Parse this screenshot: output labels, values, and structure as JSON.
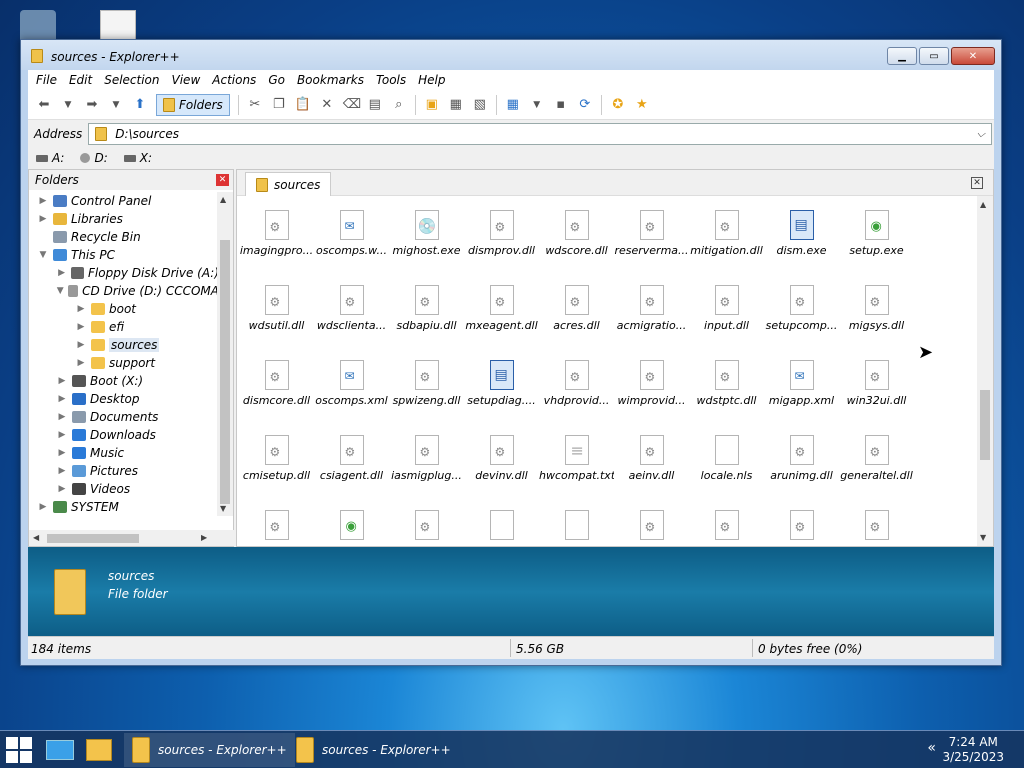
{
  "window": {
    "title": "sources - Explorer++"
  },
  "menu": [
    "File",
    "Edit",
    "Selection",
    "View",
    "Actions",
    "Go",
    "Bookmarks",
    "Tools",
    "Help"
  ],
  "toolbar": {
    "folders_label": "Folders"
  },
  "address": {
    "label": "Address",
    "value": "D:\\sources"
  },
  "drives": [
    "A:",
    "D:",
    "X:"
  ],
  "folders_pane": {
    "title": "Folders",
    "items": [
      {
        "label": "Control Panel",
        "indent": 0,
        "arrow": ">",
        "icon_color": "#4a7cc4"
      },
      {
        "label": "Libraries",
        "indent": 0,
        "arrow": ">",
        "icon_color": "#e8b63c"
      },
      {
        "label": "Recycle Bin",
        "indent": 0,
        "arrow": "",
        "icon_color": "#8a9aac"
      },
      {
        "label": "This PC",
        "indent": 0,
        "arrow": "v",
        "icon_color": "#3f8ad8"
      },
      {
        "label": "Floppy Disk Drive (A:)",
        "indent": 1,
        "arrow": ">",
        "icon_color": "#666666"
      },
      {
        "label": "CD Drive (D:) CCCOMA",
        "indent": 1,
        "arrow": "v",
        "icon_color": "#999999"
      },
      {
        "label": "boot",
        "indent": 2,
        "arrow": ">",
        "icon_color": "#f3c34b"
      },
      {
        "label": "efi",
        "indent": 2,
        "arrow": ">",
        "icon_color": "#f3c34b"
      },
      {
        "label": "sources",
        "indent": 2,
        "arrow": ">",
        "icon_color": "#f3c34b",
        "selected": true
      },
      {
        "label": "support",
        "indent": 2,
        "arrow": ">",
        "icon_color": "#f3c34b"
      },
      {
        "label": "Boot (X:)",
        "indent": 1,
        "arrow": ">",
        "icon_color": "#555555"
      },
      {
        "label": "Desktop",
        "indent": 1,
        "arrow": ">",
        "icon_color": "#2a6fc8"
      },
      {
        "label": "Documents",
        "indent": 1,
        "arrow": ">",
        "icon_color": "#8a9aac"
      },
      {
        "label": "Downloads",
        "indent": 1,
        "arrow": ">",
        "icon_color": "#2a7ad8"
      },
      {
        "label": "Music",
        "indent": 1,
        "arrow": ">",
        "icon_color": "#2a7ad8"
      },
      {
        "label": "Pictures",
        "indent": 1,
        "arrow": ">",
        "icon_color": "#5a9ad8"
      },
      {
        "label": "Videos",
        "indent": 1,
        "arrow": ">",
        "icon_color": "#444444"
      },
      {
        "label": "SYSTEM",
        "indent": 0,
        "arrow": ">",
        "icon_color": "#4a8a4a"
      }
    ]
  },
  "tab": {
    "label": "sources"
  },
  "files": [
    {
      "name": "imagingpro...",
      "kind": "dll"
    },
    {
      "name": "oscomps.w...",
      "kind": "xml"
    },
    {
      "name": "mighost.exe",
      "kind": "cd"
    },
    {
      "name": "dismprov.dll",
      "kind": "dll"
    },
    {
      "name": "wdscore.dll",
      "kind": "dll"
    },
    {
      "name": "reserverma...",
      "kind": "dll"
    },
    {
      "name": "mitigation.dll",
      "kind": "dll"
    },
    {
      "name": "dism.exe",
      "kind": "app"
    },
    {
      "name": "setup.exe",
      "kind": "exe"
    },
    {
      "name": "wdsutil.dll",
      "kind": "dll"
    },
    {
      "name": "wdsclienta...",
      "kind": "dll"
    },
    {
      "name": "sdbapiu.dll",
      "kind": "dll"
    },
    {
      "name": "mxeagent.dll",
      "kind": "dll"
    },
    {
      "name": "acres.dll",
      "kind": "dll"
    },
    {
      "name": "acmigratio...",
      "kind": "dll"
    },
    {
      "name": "input.dll",
      "kind": "dll"
    },
    {
      "name": "setupcomp...",
      "kind": "dll"
    },
    {
      "name": "migsys.dll",
      "kind": "dll"
    },
    {
      "name": "dismcore.dll",
      "kind": "dll"
    },
    {
      "name": "oscomps.xml",
      "kind": "xml"
    },
    {
      "name": "spwizeng.dll",
      "kind": "dll"
    },
    {
      "name": "setupdiag....",
      "kind": "app"
    },
    {
      "name": "vhdprovid...",
      "kind": "dll"
    },
    {
      "name": "wimprovid...",
      "kind": "dll"
    },
    {
      "name": "wdstptc.dll",
      "kind": "dll"
    },
    {
      "name": "migapp.xml",
      "kind": "xml"
    },
    {
      "name": "win32ui.dll",
      "kind": "dll"
    },
    {
      "name": "cmisetup.dll",
      "kind": "dll"
    },
    {
      "name": "csiagent.dll",
      "kind": "dll"
    },
    {
      "name": "iasmigplug...",
      "kind": "dll"
    },
    {
      "name": "devinv.dll",
      "kind": "dll"
    },
    {
      "name": "hwcompat.txt",
      "kind": "txt"
    },
    {
      "name": "aeinv.dll",
      "kind": "dll"
    },
    {
      "name": "locale.nls",
      "kind": "blank"
    },
    {
      "name": "arunimg.dll",
      "kind": "dll"
    },
    {
      "name": "generaltel.dll",
      "kind": "dll"
    },
    {
      "name": "",
      "kind": "dll"
    },
    {
      "name": "",
      "kind": "exe"
    },
    {
      "name": "",
      "kind": "dll"
    },
    {
      "name": "",
      "kind": "blank"
    },
    {
      "name": "",
      "kind": "blank"
    },
    {
      "name": "",
      "kind": "dll"
    },
    {
      "name": "",
      "kind": "dll"
    },
    {
      "name": "",
      "kind": "dll"
    },
    {
      "name": "",
      "kind": "dll"
    }
  ],
  "info": {
    "name": "sources",
    "type": "File folder"
  },
  "status": {
    "items": "184 items",
    "size": "5.56 GB",
    "free": "0 bytes free (0%)"
  },
  "taskbar": {
    "item1": "sources - Explorer++",
    "item2": "sources - Explorer++",
    "time": "7:24 AM",
    "date": "3/25/2023"
  },
  "colors": {
    "accent": "#3f8ad8",
    "folder": "#f3c34b",
    "info_pane": "#1a7ca8"
  }
}
